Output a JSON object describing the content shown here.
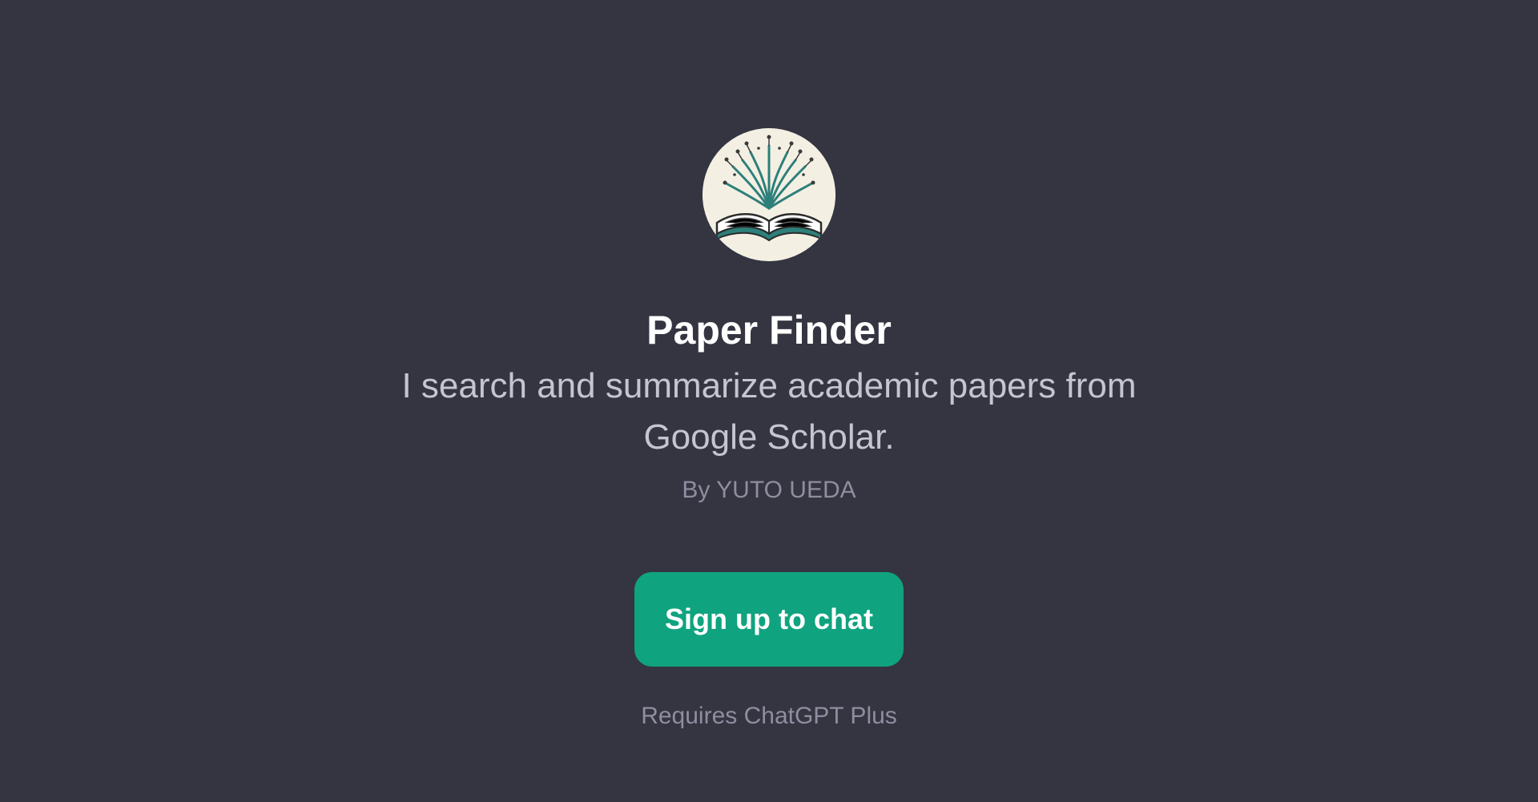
{
  "gpt": {
    "name": "Paper Finder",
    "description": "I search and summarize academic papers from Google Scholar.",
    "author": "By YUTO UEDA",
    "avatar_icon": "open-book-circuit-icon"
  },
  "actions": {
    "signup_label": "Sign up to chat",
    "requirement_note": "Requires ChatGPT Plus"
  },
  "colors": {
    "background": "#343541",
    "accent": "#10a37f",
    "title": "#ffffff",
    "text_secondary": "#c5c5d2",
    "text_muted": "#8e8ea0"
  }
}
